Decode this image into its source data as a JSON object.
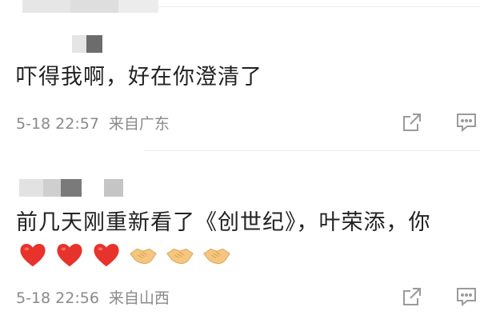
{
  "comments": [
    {
      "text": "吓得我啊，好在你澄清了",
      "time": "5-18 22:57",
      "source": "来自广东",
      "emojis": []
    },
    {
      "text": "前几天刚重新看了《创世纪》，叶荣添，你",
      "time": "5-18 22:56",
      "source": "来自山西",
      "emojis": [
        "red-heart",
        "red-heart",
        "red-heart",
        "handshake",
        "handshake",
        "handshake"
      ]
    }
  ],
  "actions": {
    "share_icon": "share-icon",
    "reply_icon": "comment-icon"
  },
  "colors": {
    "text": "#222222",
    "meta": "#8a8a8a",
    "divider": "#ececec",
    "heart": "#e8322c",
    "handshake": "#f5c77e"
  }
}
